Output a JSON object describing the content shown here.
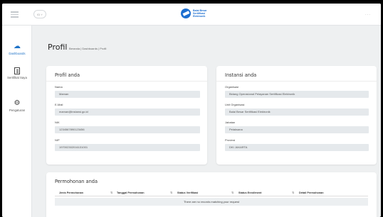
{
  "header": {
    "logo_text_1": "Balai Besar",
    "logo_text_2": "Sertifikasi",
    "logo_text_3": "Elektronik",
    "lang": "ID ˅",
    "more": "..."
  },
  "sidebar": {
    "items": [
      {
        "label": "Dashboards",
        "icon": "cloud-icon",
        "active": true
      },
      {
        "label": "Sertifikat Saya",
        "icon": "certificate-icon",
        "active": false
      },
      {
        "label": "Pengaturan",
        "icon": "gear-icon",
        "active": false
      }
    ]
  },
  "page": {
    "title": "Profil",
    "breadcrumb": "Beranda | Dashboards | Profil"
  },
  "profil": {
    "title": "Profil anda",
    "fields": [
      {
        "label": "Nama",
        "value": "Maman"
      },
      {
        "label": "E-Mail",
        "value": "maman@instansi.go.id"
      },
      {
        "label": "NIK",
        "value": "1234567890123456"
      },
      {
        "label": "NIP",
        "value": "197002302016131001"
      }
    ]
  },
  "instansi": {
    "title": "Instansi anda",
    "fields": [
      {
        "label": "Organisasi",
        "value": "Bidang Operasional Pelayanan Sertifikasi Elektronik"
      },
      {
        "label": "Unit Organisasi",
        "value": "Balai Besar Sertifikasi Elektronik"
      },
      {
        "label": "Jabatan",
        "value": "Pelaksana"
      },
      {
        "label": "Provinsi",
        "value": "DKI JAKARTA"
      }
    ]
  },
  "permohonan": {
    "title": "Permohonan anda",
    "columns": [
      "Jenis Permohonan",
      "Tanggal Permohonan",
      "Status Verifikasi",
      "Status Enrollment",
      "Detail Permohonan"
    ],
    "empty_message": "There are no records matching your request"
  }
}
